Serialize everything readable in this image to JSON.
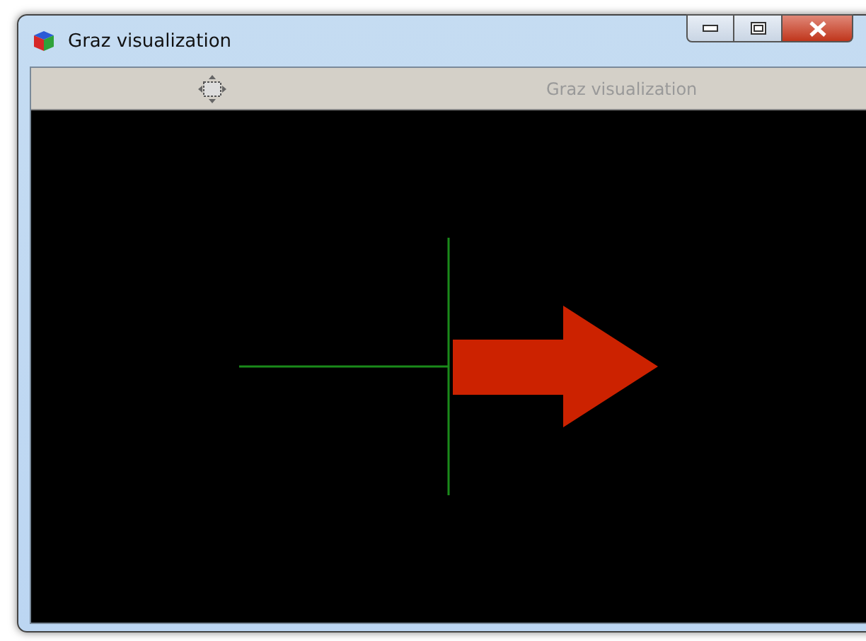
{
  "window": {
    "title": "Graz visualization"
  },
  "toolbar": {
    "title": "Graz visualization"
  }
}
